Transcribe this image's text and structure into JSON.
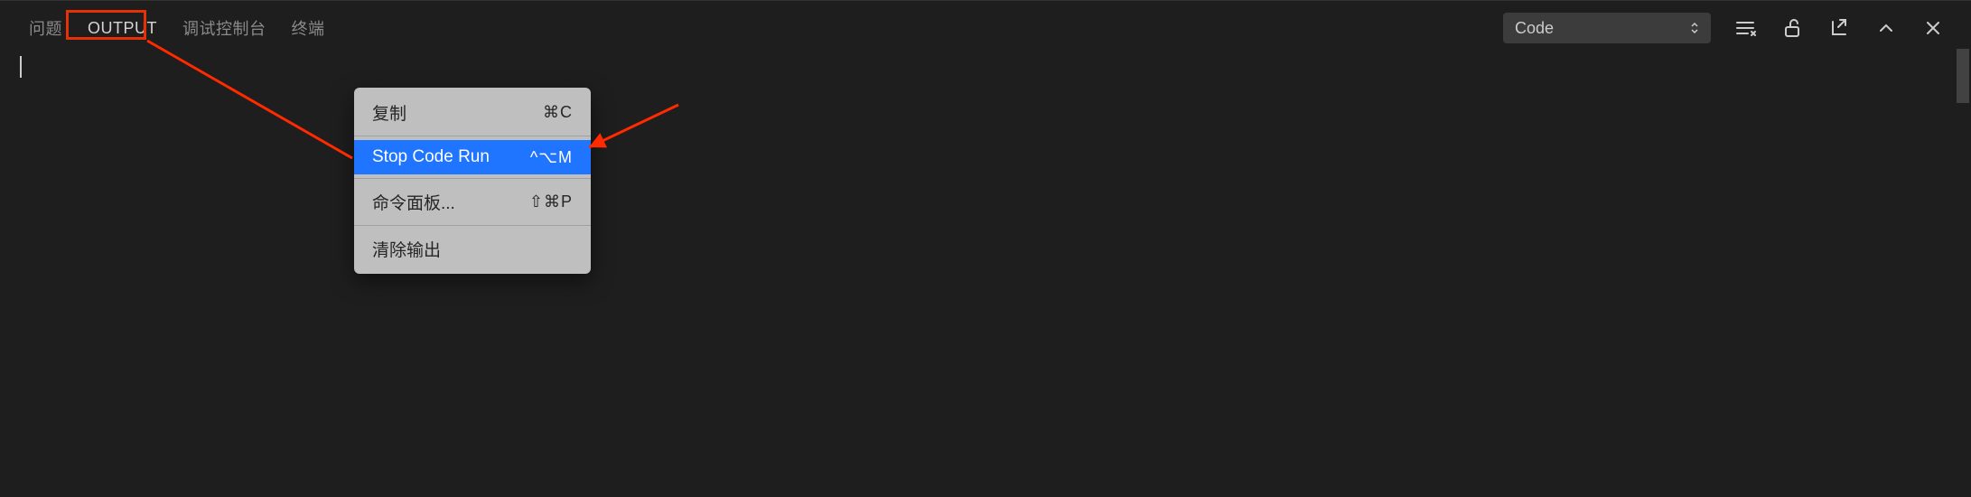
{
  "tabs": {
    "problems": "问题",
    "output": "OUTPUT",
    "debug_console": "调试控制台",
    "terminal": "终端"
  },
  "dropdown": {
    "selected": "Code"
  },
  "context_menu": {
    "copy": {
      "label": "复制",
      "shortcut": "⌘C"
    },
    "stop_code_run": {
      "label": "Stop Code Run",
      "shortcut": "^⌥M"
    },
    "command_palette": {
      "label": "命令面板...",
      "shortcut": "⇧⌘P"
    },
    "clear_output": {
      "label": "清除输出",
      "shortcut": ""
    }
  },
  "annotations": {
    "box_color": "#e63107",
    "arrow_color": "#ff2a00"
  }
}
